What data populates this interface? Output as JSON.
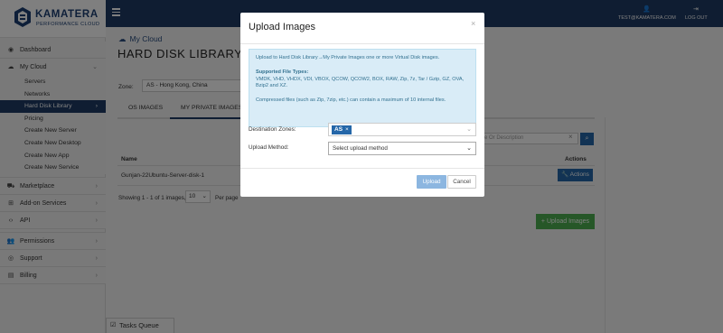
{
  "logo": {
    "name": "KAMATERA",
    "tagline": "PERFORMANCE CLOUD"
  },
  "topbar": {
    "user": "TEST@KAMATERA.COM",
    "logout": "LOG OUT"
  },
  "sidebar": {
    "dashboard": "Dashboard",
    "my_cloud": "My Cloud",
    "sub": [
      "Servers",
      "Networks",
      "Hard Disk Library",
      "Pricing",
      "Create New Server",
      "Create New Desktop",
      "Create New App",
      "Create New Service"
    ],
    "marketplace": "Marketplace",
    "addon": "Add-on Services",
    "api": "API",
    "permissions": "Permissions",
    "support": "Support",
    "billing": "Billing"
  },
  "page": {
    "breadcrumb": "My Cloud",
    "title": "HARD DISK LIBRARY",
    "zone_label": "Zone:",
    "zone_value": "AS - Hong Kong, China",
    "tabs": [
      "OS IMAGES",
      "MY PRIVATE IMAGES"
    ],
    "search_placeholder": "e Or Description",
    "table": {
      "col_name": "Name",
      "col_actions": "Actions",
      "row_name": "Gunjan-22Ubuntu-Server-disk-1",
      "actions_btn": "Actions"
    },
    "showing": "Showing 1 - 1 of 1 images,",
    "per_page_value": "10",
    "per_page_label": "Per page",
    "upload_images_btn": "Upload Images"
  },
  "tasks": {
    "label": "Tasks Queue"
  },
  "modal": {
    "title": "Upload Images",
    "close": "×",
    "info_intro": "Upload to Hard Disk Library→My Private Images one or more Virtual Disk images.",
    "info_types_title": "Supported File Types:",
    "info_types": "VMDK, VHD, VHDX, VDI, VBOX, QCOW, QCOW2, BOX, RAW, Zip, 7z, Tar / Gzip, GZ, OVA, Bzip2 and XZ.",
    "info_note": "Compressed files (such as Zip, 7zip, etc.) can contain a maximum of 10 internal files.",
    "dest_label": "Destination Zones:",
    "dest_tag": "AS",
    "dest_tag_x": "×",
    "method_label": "Upload Method:",
    "method_value": "Select upload method",
    "upload_btn": "Upload",
    "cancel_btn": "Cancel"
  }
}
